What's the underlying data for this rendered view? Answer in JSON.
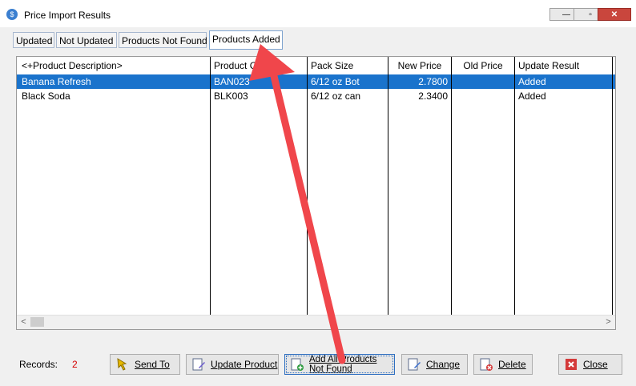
{
  "window": {
    "title": "Price Import Results",
    "icon": "price-import-icon",
    "controls": {
      "minimize": "—",
      "maximize": "▫",
      "close": "✕"
    }
  },
  "tabs": [
    {
      "label": "Updated",
      "active": false
    },
    {
      "label": "Not Updated",
      "active": false
    },
    {
      "label": "Products Not Found",
      "active": false
    },
    {
      "label": "Products Added",
      "active": true
    }
  ],
  "grid": {
    "columns": [
      "<+Product Description>",
      "Product Code",
      "Pack Size",
      "New Price",
      "Old Price",
      "Update Result"
    ],
    "rows": [
      {
        "cells": [
          "Banana Refresh",
          "BAN023",
          "6/12 oz Bot",
          "2.7800",
          "",
          "Added"
        ],
        "selected": true
      },
      {
        "cells": [
          "Black Soda",
          "BLK003",
          "6/12 oz can",
          "2.3400",
          "",
          "Added"
        ],
        "selected": false
      }
    ],
    "scroll_left": "<",
    "scroll_right": ">"
  },
  "footer": {
    "records_label": "Records:",
    "records_value": "2",
    "buttons": {
      "send_to": "Send To",
      "update_product": "Update Product",
      "add_all": "Add All Products Not Found",
      "change": "Change",
      "delete": "Delete",
      "close": "Close"
    }
  },
  "colors": {
    "selection": "#1a73cc",
    "annotation_arrow": "#f0464b",
    "records_value": "#d40000"
  }
}
